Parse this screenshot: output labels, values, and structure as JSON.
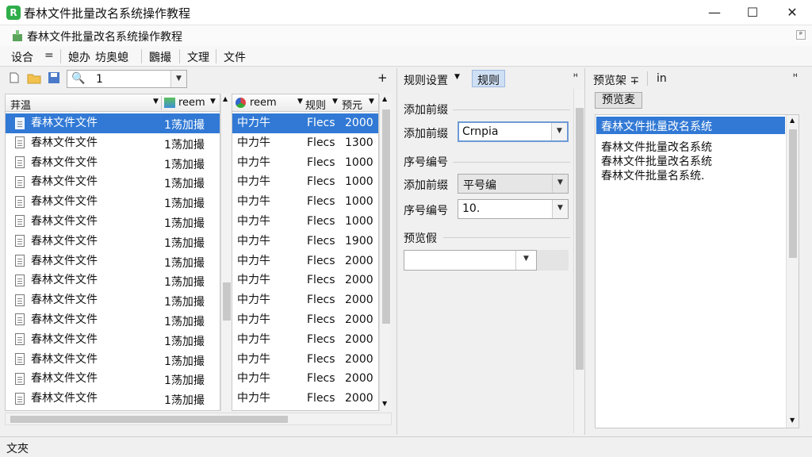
{
  "window": {
    "title": "春林文件批量改名系统操作教程",
    "minimize": "—",
    "maximize": "☐",
    "close": "✕"
  },
  "subbar": {
    "title": "春林文件批量改名系统操作教程"
  },
  "menu": [
    "设合",
    "=",
    "媳办",
    "坊奥螅",
    "鶠撮",
    "文理",
    "文件"
  ],
  "left_toolbar": {
    "search_value": "1",
    "plus": "+"
  },
  "file_list": {
    "headers": [
      "荓温",
      "reem",
      "reem",
      "规则",
      "预元"
    ],
    "rows": [
      {
        "name": "春林文件文件",
        "size": "1荡加撮",
        "type": "中力牛",
        "kind": "Flecs",
        "num": "2000"
      },
      {
        "name": "春林文件文件",
        "size": "1荡加撮",
        "type": "中力牛",
        "kind": "Flecs",
        "num": "1300"
      },
      {
        "name": "春林文件文件",
        "size": "1荡加撮",
        "type": "中力牛",
        "kind": "Flecs",
        "num": "1000"
      },
      {
        "name": "春林文件文件",
        "size": "1荡加撮",
        "type": "中力牛",
        "kind": "Flecs",
        "num": "1000"
      },
      {
        "name": "春林文件文件",
        "size": "1荡加撮",
        "type": "中力牛",
        "kind": "Flecs",
        "num": "1000"
      },
      {
        "name": "春林文件文件",
        "size": "1荡加撮",
        "type": "中力牛",
        "kind": "Flecs",
        "num": "1000"
      },
      {
        "name": "春林文件文件",
        "size": "1荡加撮",
        "type": "中力牛",
        "kind": "Flecs",
        "num": "1900"
      },
      {
        "name": "春林文件文件",
        "size": "1荡加撮",
        "type": "中力牛",
        "kind": "Flecs",
        "num": "2000"
      },
      {
        "name": "春林文件文件",
        "size": "1荡加撮",
        "type": "中力牛",
        "kind": "Flecs",
        "num": "2000"
      },
      {
        "name": "春林文件文件",
        "size": "1荡加撮",
        "type": "中力牛",
        "kind": "Flecs",
        "num": "2000"
      },
      {
        "name": "春林文件文件",
        "size": "1荡加撮",
        "type": "中力牛",
        "kind": "Flecs",
        "num": "2000"
      },
      {
        "name": "春林文件文件",
        "size": "1荡加撮",
        "type": "中力牛",
        "kind": "Flecs",
        "num": "2000"
      },
      {
        "name": "春林文件文件",
        "size": "1荡加撮",
        "type": "中力牛",
        "kind": "Flecs",
        "num": "2000"
      },
      {
        "name": "春林文件文件",
        "size": "1荡加撮",
        "type": "中力牛",
        "kind": "Flecs",
        "num": "2000"
      },
      {
        "name": "春林文件文件",
        "size": "1荡加撮",
        "type": "中力牛",
        "kind": "Flecs",
        "num": "2000"
      }
    ]
  },
  "rules_panel": {
    "tab_label": "规则设置",
    "tab_active": "规则",
    "pin": "ᴴ",
    "section_prefix": "添加前缀",
    "prefix_label": "添加前缀",
    "prefix_value": "Crnpia",
    "section_seq": "序号编号",
    "seq_field_label": "添加前缀",
    "seq_field_value": "平号编",
    "seq_label": "序号编号",
    "seq_value": "10.",
    "section_preview": "预览假",
    "preview_value": ""
  },
  "preview_panel": {
    "tab_label": "预览架 ∓",
    "tab2_label": "in",
    "pin": "ᴴ",
    "button": "预览麦",
    "selected_item": "春林文件批量改名系统",
    "lines": [
      "春林文件批量改名系统",
      "春林文件批量改名系统",
      "春林文件批量名系统."
    ]
  },
  "status": {
    "text": "文夾"
  },
  "colors": {
    "selection": "#3179d5",
    "app_icon": "#2fae4a"
  }
}
